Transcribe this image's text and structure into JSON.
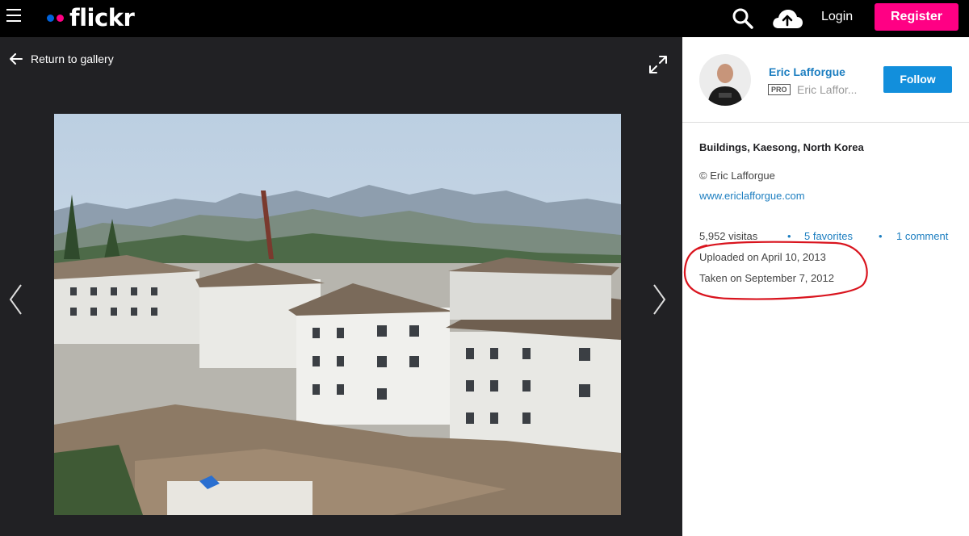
{
  "nav": {
    "logo_text": "flickr",
    "login_label": "Login",
    "register_label": "Register",
    "brand_blue": "#0063dc",
    "brand_pink": "#ff0084"
  },
  "photo_view": {
    "return_label": "Return to gallery"
  },
  "sidebar": {
    "owner_name": "Eric Lafforgue",
    "pro_badge": "PRO",
    "owner_subname": "Eric Laffor...",
    "follow_label": "Follow",
    "photo_title": "Buildings, Kaesong, North Korea",
    "copyright": "© Eric Lafforgue",
    "website": "www.ericlafforgue.com",
    "views": "5,952 visitas",
    "favorites": "5 favorites",
    "comments": "1 comment",
    "uploaded": "Uploaded on April 10, 2013",
    "taken": "Taken on September 7, 2012",
    "link_color": "#1c7ec0",
    "follow_color": "#128fdc",
    "annotation_color": "#d9141e"
  }
}
